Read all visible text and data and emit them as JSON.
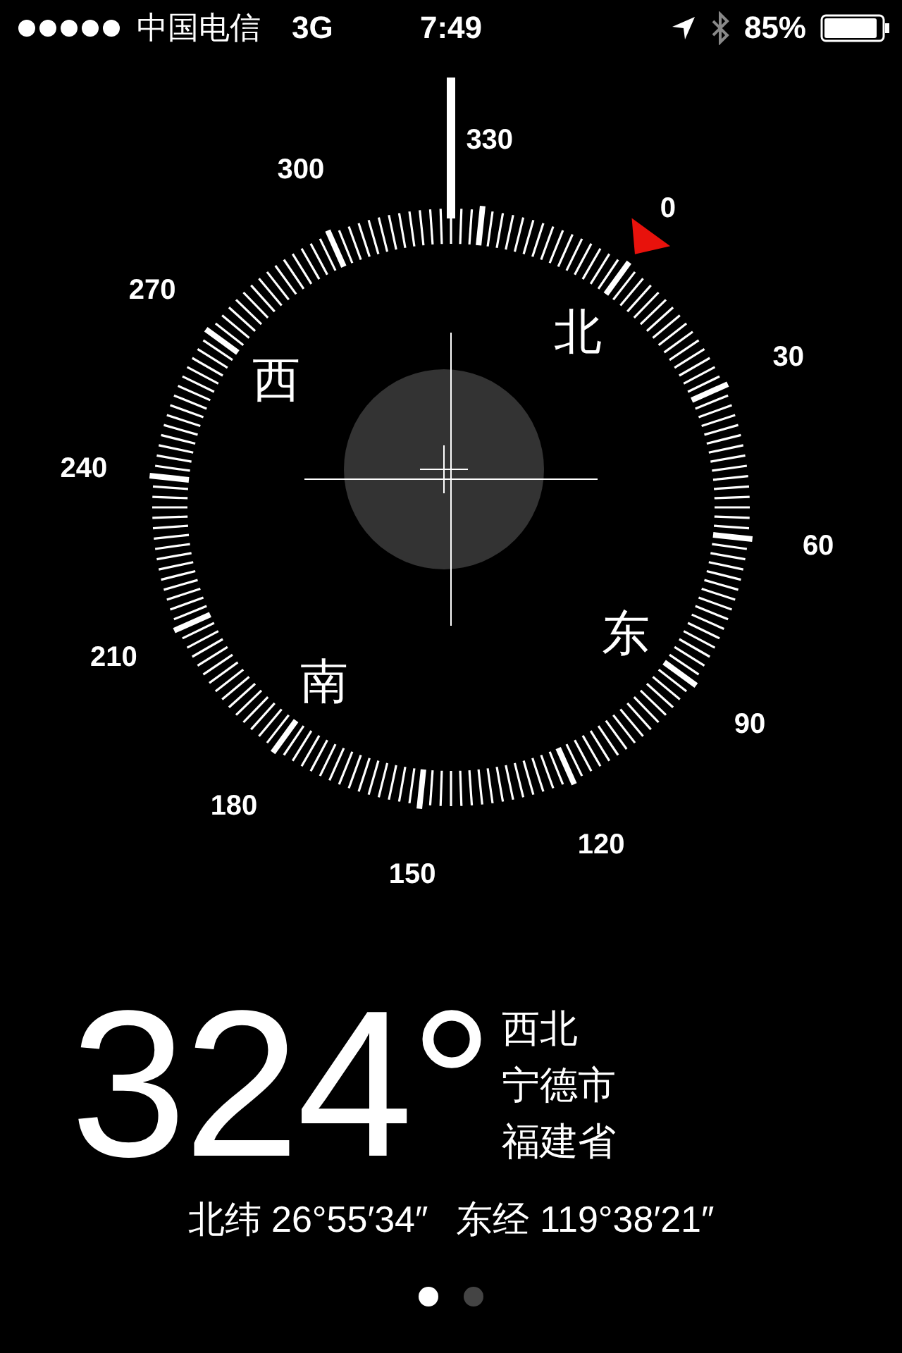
{
  "status_bar": {
    "carrier": "中国电信",
    "network": "3G",
    "time": "7:49",
    "battery": "85%"
  },
  "compass": {
    "dial_labels": [
      "0",
      "30",
      "60",
      "90",
      "120",
      "150",
      "180",
      "210",
      "240",
      "270",
      "300",
      "330"
    ],
    "cardinals": [
      "北",
      "东",
      "南",
      "西"
    ]
  },
  "readout": {
    "heading": "324°",
    "direction": "西北",
    "city": "宁德市",
    "province": "福建省"
  },
  "coordinates": {
    "latitude": "北纬 26°55′34″",
    "longitude": "东经 119°38′21″"
  },
  "pages": [
    {
      "selected": true
    },
    {
      "selected": false
    }
  ]
}
